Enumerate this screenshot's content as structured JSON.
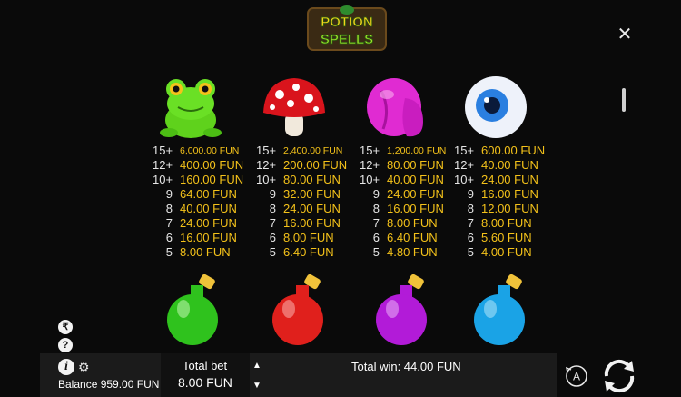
{
  "logo": {
    "line1": "POTION",
    "line2": "SPELLS"
  },
  "close_icon": "close-icon",
  "paytable": [
    {
      "symbol": "frog",
      "rows": [
        {
          "count": "15+",
          "value": "6,000.00 FUN",
          "small": true
        },
        {
          "count": "12+",
          "value": "400.00 FUN"
        },
        {
          "count": "10+",
          "value": "160.00 FUN"
        },
        {
          "count": "9",
          "value": "64.00 FUN"
        },
        {
          "count": "8",
          "value": "40.00 FUN"
        },
        {
          "count": "7",
          "value": "24.00 FUN"
        },
        {
          "count": "6",
          "value": "16.00 FUN"
        },
        {
          "count": "5",
          "value": "8.00 FUN"
        }
      ]
    },
    {
      "symbol": "mushroom",
      "rows": [
        {
          "count": "15+",
          "value": "2,400.00 FUN",
          "small": true
        },
        {
          "count": "12+",
          "value": "200.00 FUN"
        },
        {
          "count": "10+",
          "value": "80.00 FUN"
        },
        {
          "count": "9",
          "value": "32.00 FUN"
        },
        {
          "count": "8",
          "value": "24.00 FUN"
        },
        {
          "count": "7",
          "value": "16.00 FUN"
        },
        {
          "count": "6",
          "value": "8.00 FUN"
        },
        {
          "count": "5",
          "value": "6.40 FUN"
        }
      ]
    },
    {
      "symbol": "pink-tongue",
      "rows": [
        {
          "count": "15+",
          "value": "1,200.00 FUN",
          "small": true
        },
        {
          "count": "12+",
          "value": "80.00 FUN"
        },
        {
          "count": "10+",
          "value": "40.00 FUN"
        },
        {
          "count": "9",
          "value": "24.00 FUN"
        },
        {
          "count": "8",
          "value": "16.00 FUN"
        },
        {
          "count": "7",
          "value": "8.00 FUN"
        },
        {
          "count": "6",
          "value": "6.40 FUN"
        },
        {
          "count": "5",
          "value": "4.80 FUN"
        }
      ]
    },
    {
      "symbol": "eyeball",
      "rows": [
        {
          "count": "15+",
          "value": "600.00 FUN"
        },
        {
          "count": "12+",
          "value": "40.00 FUN"
        },
        {
          "count": "10+",
          "value": "24.00 FUN"
        },
        {
          "count": "9",
          "value": "16.00 FUN"
        },
        {
          "count": "8",
          "value": "12.00 FUN"
        },
        {
          "count": "7",
          "value": "8.00 FUN"
        },
        {
          "count": "6",
          "value": "5.60 FUN"
        },
        {
          "count": "5",
          "value": "4.00 FUN"
        }
      ]
    }
  ],
  "potions": [
    {
      "name": "green-potion",
      "color": "#2fc21d"
    },
    {
      "name": "red-potion",
      "color": "#e0201c"
    },
    {
      "name": "purple-potion",
      "color": "#b21bd8"
    },
    {
      "name": "blue-potion",
      "color": "#1aa3e6"
    }
  ],
  "side_icons": {
    "currency": "₹",
    "help": "?"
  },
  "bottom_bar": {
    "info_icon": "i",
    "balance": "Balance 959.00 FUN",
    "total_bet_label": "Total bet",
    "total_bet_value": "8.00 FUN",
    "total_win": "Total win: 44.00 FUN",
    "auto_label": "A"
  }
}
